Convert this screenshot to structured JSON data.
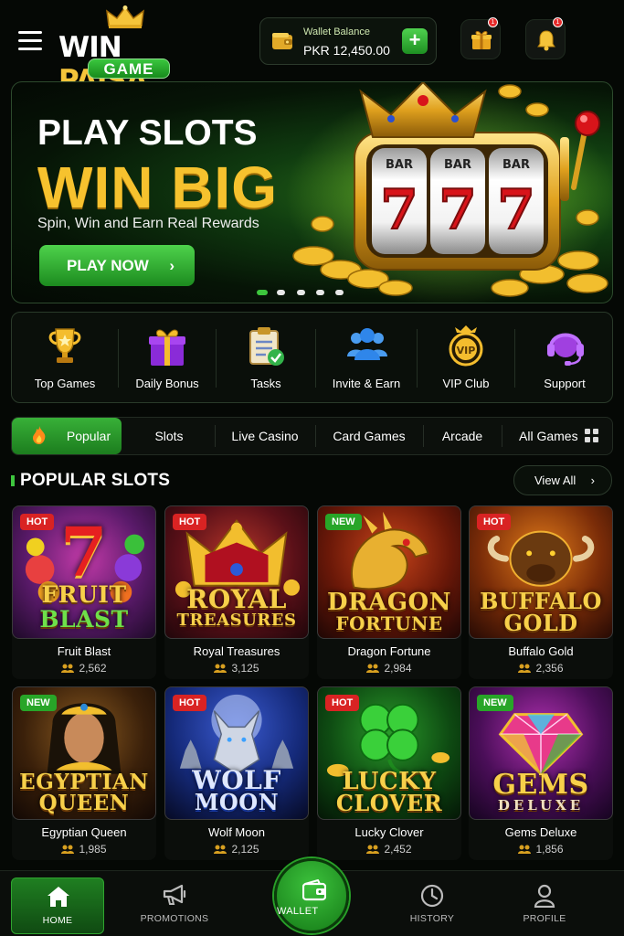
{
  "header": {
    "logo_top": "WIN",
    "logo_accent": "PAISA",
    "logo_sub": "GAME",
    "wallet_label": "Wallet Balance",
    "wallet_amount": "PKR 12,450.00",
    "add_label": "+",
    "gift_badge": "1",
    "bell_badge": "1",
    "icons": [
      "menu-icon",
      "crown-icon",
      "wallet-icon",
      "plus-icon",
      "gift-icon",
      "bell-icon"
    ]
  },
  "banner": {
    "title_line1": "PLAY SLOTS",
    "title_line2": "WIN BIG",
    "subtitle": "Spin, Win and Earn Real Rewards",
    "cta_label": "PLAY NOW",
    "reel_labels": [
      "BAR",
      "BAR",
      "BAR"
    ],
    "reel_symbols": [
      "7",
      "7",
      "7"
    ],
    "slide_count": 5,
    "active_slide": 1
  },
  "quick_links": [
    {
      "label": "Top Games",
      "icon": "trophy-icon"
    },
    {
      "label": "Daily Bonus",
      "icon": "gift-box-icon"
    },
    {
      "label": "Tasks",
      "icon": "clipboard-check-icon"
    },
    {
      "label": "Invite & Earn",
      "icon": "users-icon"
    },
    {
      "label": "VIP Club",
      "icon": "vip-badge-icon"
    },
    {
      "label": "Support",
      "icon": "headset-icon"
    }
  ],
  "tabs": [
    {
      "label": "Popular",
      "active": true
    },
    {
      "label": "Slots",
      "active": false
    },
    {
      "label": "Live Casino",
      "active": false
    },
    {
      "label": "Card Games",
      "active": false
    },
    {
      "label": "Arcade",
      "active": false
    },
    {
      "label": "All Games",
      "active": false
    }
  ],
  "section": {
    "title": "POPULAR SLOTS",
    "view_all": "View All"
  },
  "games": [
    {
      "name": "Fruit Blast",
      "players": "2,562",
      "badge": "HOT",
      "art_line1": "FRUIT",
      "art_line2": "BLAST",
      "hero": "7"
    },
    {
      "name": "Royal Treasures",
      "players": "3,125",
      "badge": "HOT",
      "art_line1": "ROYAL",
      "art_line2": "TREASURES",
      "hero": ""
    },
    {
      "name": "Dragon Fortune",
      "players": "2,984",
      "badge": "NEW",
      "art_line1": "DRAGON",
      "art_line2": "FORTUNE",
      "hero": ""
    },
    {
      "name": "Buffalo Gold",
      "players": "2,356",
      "badge": "HOT",
      "art_line1": "BUFFALO",
      "art_line2": "GOLD",
      "hero": ""
    },
    {
      "name": "Egyptian Queen",
      "players": "1,985",
      "badge": "NEW",
      "art_line1": "EGYPTIAN",
      "art_line2": "QUEEN",
      "hero": ""
    },
    {
      "name": "Wolf Moon",
      "players": "2,125",
      "badge": "HOT",
      "art_line1": "WOLF",
      "art_line2": "MOON",
      "hero": ""
    },
    {
      "name": "Lucky Clover",
      "players": "2,452",
      "badge": "HOT",
      "art_line1": "LUCKY",
      "art_line2": "CLOVER",
      "hero": ""
    },
    {
      "name": "Gems Deluxe",
      "players": "1,856",
      "badge": "NEW",
      "art_line1": "GEMS",
      "art_line2": "DELUXE",
      "hero": ""
    }
  ],
  "bottom_nav": [
    {
      "label": "HOME",
      "icon": "home-icon",
      "active": true
    },
    {
      "label": "PROMOTIONS",
      "icon": "megaphone-icon",
      "active": false
    },
    {
      "label": "WALLET",
      "icon": "wallet-icon",
      "active": false
    },
    {
      "label": "HISTORY",
      "icon": "clock-icon",
      "active": false
    },
    {
      "label": "PROFILE",
      "icon": "user-icon",
      "active": false
    }
  ],
  "colors": {
    "accent_green": "#2fa52f",
    "gold": "#f6c22e",
    "hot_badge": "#d92323",
    "new_badge": "#28a528",
    "background": "#050805"
  }
}
